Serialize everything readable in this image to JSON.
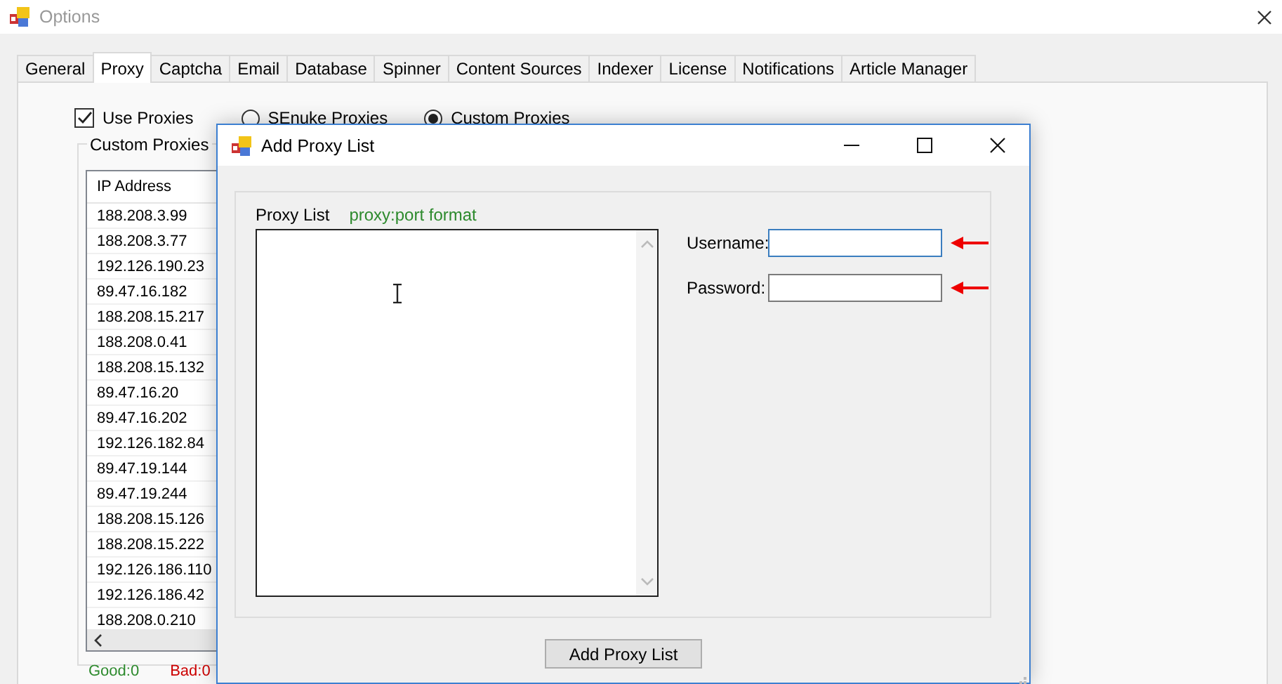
{
  "window": {
    "title": "Options"
  },
  "tabs": [
    {
      "label": "General",
      "selected": false
    },
    {
      "label": "Proxy",
      "selected": true
    },
    {
      "label": "Captcha",
      "selected": false
    },
    {
      "label": "Email",
      "selected": false
    },
    {
      "label": "Database",
      "selected": false
    },
    {
      "label": "Spinner",
      "selected": false
    },
    {
      "label": "Content Sources",
      "selected": false
    },
    {
      "label": "Indexer",
      "selected": false
    },
    {
      "label": "License",
      "selected": false
    },
    {
      "label": "Notifications",
      "selected": false
    },
    {
      "label": "Article Manager",
      "selected": false
    }
  ],
  "use_proxies": {
    "label": "Use Proxies",
    "checked": true
  },
  "proxy_source": [
    {
      "label": "SEnuke Proxies",
      "selected": false
    },
    {
      "label": "Custom Proxies",
      "selected": true
    }
  ],
  "custom_proxies": {
    "title": "Custom Proxies",
    "column": "IP Address",
    "rows": [
      "188.208.3.99",
      "188.208.3.77",
      "192.126.190.23",
      "89.47.16.182",
      "188.208.15.217",
      "188.208.0.41",
      "188.208.15.132",
      "89.47.16.20",
      "89.47.16.202",
      "192.126.182.84",
      "89.47.19.144",
      "89.47.19.244",
      "188.208.15.126",
      "188.208.15.222",
      "192.126.186.110",
      "192.126.186.42",
      "188.208.0.210"
    ],
    "good": "Good:0",
    "bad": "Bad:0"
  },
  "dialog": {
    "title": "Add Proxy List",
    "proxy_list_label": "Proxy List",
    "format_hint": "proxy:port format",
    "fields": [
      {
        "label": "Username:",
        "focused": true
      },
      {
        "label": "Password:",
        "focused": false
      }
    ],
    "button": "Add Proxy List"
  }
}
